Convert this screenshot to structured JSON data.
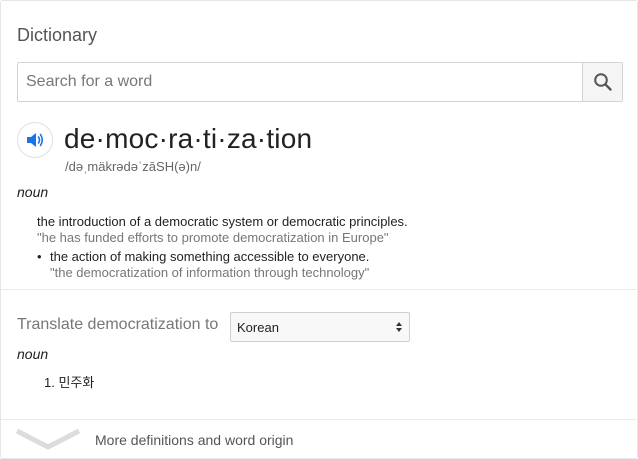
{
  "dictionary": {
    "title": "Dictionary",
    "search": {
      "placeholder": "Search for a word"
    },
    "entry": {
      "word": "de·moc·ra·ti·za·tion",
      "phonetic": "/dəˌmäkrədəˈzāSH(ə)n/",
      "part_of_speech": "noun",
      "definitions": [
        {
          "text": "the introduction of a democratic system or democratic principles.",
          "example": "\"he has funded efforts to promote democratization in Europe\""
        },
        {
          "text": "the action of making something accessible to everyone.",
          "example": "\"the democratization of information through technology\""
        }
      ]
    },
    "translate": {
      "label": "Translate democratization to",
      "language": "Korean",
      "part_of_speech": "noun",
      "results": [
        "1. 민주화"
      ]
    },
    "more_link": "More definitions and word origin"
  },
  "icons": {
    "search": "search-icon",
    "audio": "speaker-icon",
    "select_arrows": "up-down-arrows-icon",
    "expand": "chevron-down-icon"
  },
  "colors": {
    "accent_blue": "#1a73e8",
    "text_primary": "#222222",
    "text_secondary": "#777777"
  }
}
